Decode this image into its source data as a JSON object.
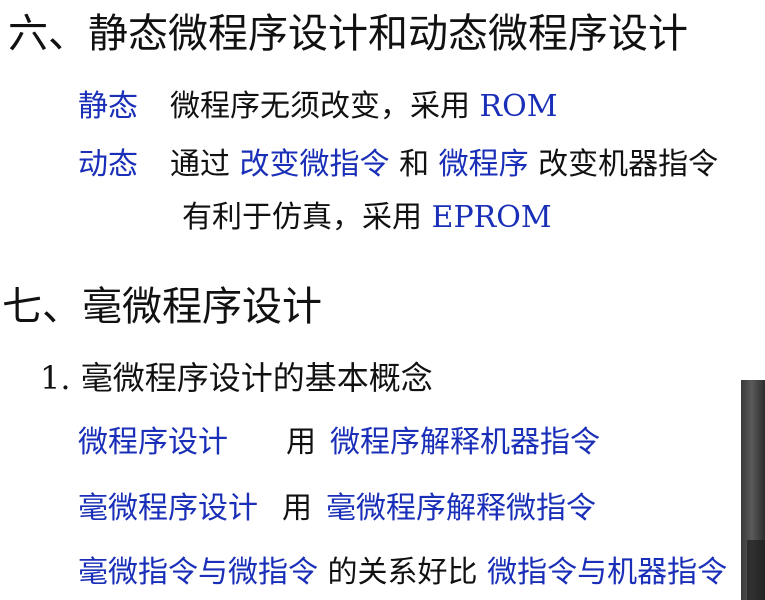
{
  "section6": {
    "title": "六、静态微程序设计和动态微程序设计",
    "static": {
      "label": "静态",
      "text": "微程序无须改变，采用 ",
      "highlight": "ROM"
    },
    "dynamic": {
      "label": "动态",
      "t1": "通过 ",
      "h1": "改变微指令",
      "t2": " 和 ",
      "h2": "微程序",
      "t3": " 改变机器指令",
      "line2_text": "有利于仿真，采用 ",
      "line2_highlight": "EPROM"
    }
  },
  "section7": {
    "title": "七、毫微程序设计",
    "subtitle": "1. 毫微程序设计的基本概念",
    "row1": {
      "label": "微程序设计",
      "verb": "用",
      "object": "微程序解释机器指令"
    },
    "row2": {
      "label": "毫微程序设计",
      "verb": "用",
      "object": "毫微程序解释微指令"
    },
    "row3": {
      "a": "毫微指令与微指令",
      "mid": " 的关系好比 ",
      "b": "微指令与机器指令"
    }
  },
  "colors": {
    "blue": "#1a2fb8",
    "text": "#111111",
    "background": "#ffffff"
  }
}
